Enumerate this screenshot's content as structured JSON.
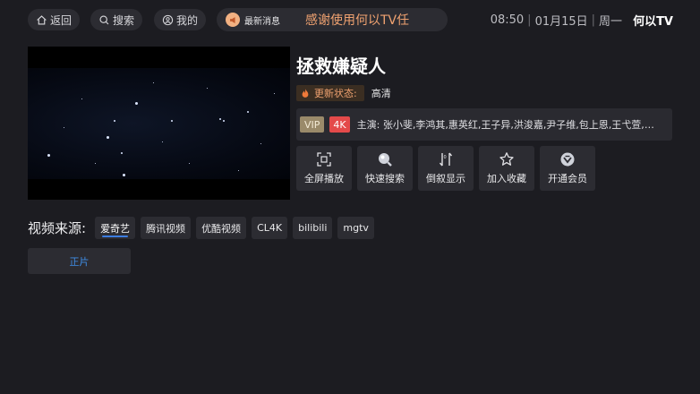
{
  "top": {
    "back_label": "返回",
    "search_label": "搜索",
    "mine_label": "我的",
    "notice_label": "最新消息",
    "notice_text": "感谢使用何以TV任",
    "time": "08:50",
    "date": "01月15日",
    "weekday": "周一",
    "brand": "何以TV"
  },
  "video": {
    "title": "拯救嫌疑人",
    "status_label": "更新状态:",
    "status_value": "高清",
    "tag_vip": "VIP",
    "tag_4k": "4K",
    "cast": "主演: 张小斐,李鸿其,惠英红,王子异,洪浚嘉,尹子维,包上恩,王弋萱,汤..."
  },
  "actions": [
    {
      "label": "全屏播放",
      "icon": "fullscreen-icon"
    },
    {
      "label": "快速搜索",
      "icon": "search-icon"
    },
    {
      "label": "倒叙显示",
      "icon": "sort-icon"
    },
    {
      "label": "加入收藏",
      "icon": "star-icon"
    },
    {
      "label": "开通会员",
      "icon": "vip-icon"
    }
  ],
  "sources": {
    "label": "视频来源:",
    "items": [
      "爱奇艺",
      "腾讯视频",
      "优酷视频",
      "CL4K",
      "bilibili",
      "mgtv"
    ],
    "active_index": 0
  },
  "episodes": [
    "正片"
  ],
  "colors": {
    "background": "#1c1c21",
    "panel": "#2c2c32",
    "accent_orange": "#f0a270",
    "accent_blue": "#3f8ee8",
    "tag_4k": "#e44a4a",
    "tag_vip": "#9a8a6a"
  }
}
